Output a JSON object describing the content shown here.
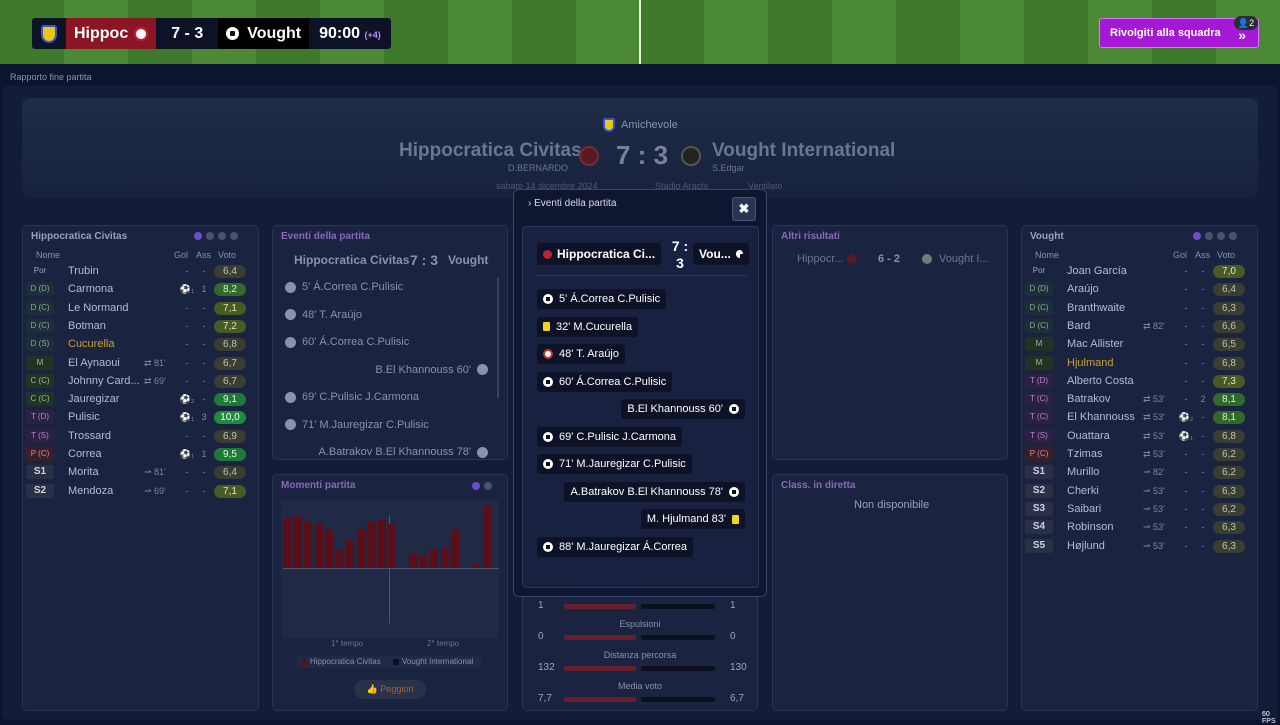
{
  "scorebar": {
    "home_team": "Hippoc",
    "score": "7 - 3",
    "away_team": "Vought",
    "time": "90:00",
    "added_time": "(+4)"
  },
  "talk_button": {
    "label": "Rivolgiti alla squadra",
    "badge": "2"
  },
  "report_label": "Rapporto fine partita",
  "header": {
    "competition": "Amichevole",
    "home_team": "Hippocratica Civitas",
    "away_team": "Vought International",
    "score": "7 : 3",
    "home_coach": "D.BERNARDO",
    "away_coach": "S.Edgar",
    "date": "sabato 14 dicembre 2024",
    "stadium": "Stadio Arachi",
    "weather": "Ventilato"
  },
  "home_lineup": {
    "title": "Hippocratica Civitas",
    "col_name": "Nome",
    "col_gol": "Gol",
    "col_ass": "Ass",
    "col_voto": "Voto",
    "players": [
      {
        "pos": "Por",
        "name": "Trubin",
        "gol": "-",
        "ass": "-",
        "voto": "6,4"
      },
      {
        "pos": "D (D)",
        "name": "Carmona",
        "gol": "⚽₁",
        "ass": "1",
        "voto": "8,2"
      },
      {
        "pos": "D (C)",
        "name": "Le Normand",
        "gol": "-",
        "ass": "-",
        "voto": "7,1"
      },
      {
        "pos": "D (C)",
        "name": "Botman",
        "gol": "-",
        "ass": "-",
        "voto": "7,2"
      },
      {
        "pos": "D (S)",
        "name": "Cucurella",
        "gol": "-",
        "ass": "-",
        "voto": "6,8"
      },
      {
        "pos": "M",
        "name": "El Aynaoui",
        "sub": "⇄ 81'",
        "gol": "-",
        "ass": "-",
        "voto": "6,7"
      },
      {
        "pos": "C (C)",
        "name": "Johnny Card...",
        "sub": "⇄ 69'",
        "gol": "-",
        "ass": "-",
        "voto": "6,7"
      },
      {
        "pos": "C (C)",
        "name": "Jauregizar",
        "gol": "⚽₂",
        "ass": "-",
        "voto": "9,1"
      },
      {
        "pos": "T (D)",
        "name": "Pulisic",
        "gol": "⚽₁",
        "ass": "3",
        "voto": "10,0"
      },
      {
        "pos": "T (S)",
        "name": "Trossard",
        "gol": "-",
        "ass": "-",
        "voto": "6,9"
      },
      {
        "pos": "P (C)",
        "name": "Correa",
        "gol": "⚽₁",
        "ass": "1",
        "voto": "9,5"
      },
      {
        "pos": "S1",
        "name": "Morita",
        "sub": "⇀ 81'",
        "gol": "-",
        "ass": "-",
        "voto": "6,4"
      },
      {
        "pos": "S2",
        "name": "Mendoza",
        "sub": "⇀ 69'",
        "gol": "-",
        "ass": "-",
        "voto": "7,1"
      }
    ]
  },
  "away_lineup": {
    "title": "Vought",
    "col_name": "Nome",
    "col_gol": "Gol",
    "col_ass": "Ass",
    "col_voto": "Voto",
    "players": [
      {
        "pos": "Por",
        "name": "Joan García",
        "gol": "-",
        "ass": "-",
        "voto": "7,0"
      },
      {
        "pos": "D (D)",
        "name": "Araújo",
        "gol": "-",
        "ass": "-",
        "voto": "6,4"
      },
      {
        "pos": "D (C)",
        "name": "Branthwaite",
        "gol": "-",
        "ass": "-",
        "voto": "6,3"
      },
      {
        "pos": "D (C)",
        "name": "Bard",
        "sub": "⇄ 82'",
        "gol": "-",
        "ass": "-",
        "voto": "6,6"
      },
      {
        "pos": "M",
        "name": "Mac Allister",
        "gol": "-",
        "ass": "-",
        "voto": "6,5"
      },
      {
        "pos": "M",
        "name": "Hjulmand",
        "gol": "-",
        "ass": "-",
        "voto": "6,8"
      },
      {
        "pos": "T (D)",
        "name": "Alberto Costa",
        "gol": "-",
        "ass": "-",
        "voto": "7,3"
      },
      {
        "pos": "T (C)",
        "name": "Batrakov",
        "sub": "⇄ 53'",
        "gol": "-",
        "ass": "2",
        "voto": "8,1"
      },
      {
        "pos": "T (C)",
        "name": "El Khannouss",
        "sub": "⇄ 53'",
        "gol": "⚽₂",
        "ass": "-",
        "voto": "8,1"
      },
      {
        "pos": "T (S)",
        "name": "Ouattara",
        "sub": "⇄ 53'",
        "gol": "⚽₁",
        "ass": "-",
        "voto": "6,8"
      },
      {
        "pos": "P (C)",
        "name": "Tzimas",
        "sub": "⇄ 53'",
        "gol": "-",
        "ass": "-",
        "voto": "6,2"
      },
      {
        "pos": "S1",
        "name": "Murillo",
        "sub": "⇀ 82'",
        "gol": "-",
        "ass": "-",
        "voto": "6,2"
      },
      {
        "pos": "S2",
        "name": "Cherki",
        "sub": "⇀ 53'",
        "gol": "-",
        "ass": "-",
        "voto": "6,3"
      },
      {
        "pos": "S3",
        "name": "Saibari",
        "sub": "⇀ 53'",
        "gol": "-",
        "ass": "-",
        "voto": "6,2"
      },
      {
        "pos": "S4",
        "name": "Robinson",
        "sub": "⇀ 53'",
        "gol": "-",
        "ass": "-",
        "voto": "6,3"
      },
      {
        "pos": "S5",
        "name": "Højlund",
        "sub": "⇀ 53'",
        "gol": "-",
        "ass": "-",
        "voto": "6,3"
      }
    ]
  },
  "events_panel": {
    "title": "Eventi della partita",
    "home": "Hippocratica Civitas",
    "score": "7 : 3",
    "away": "Vought",
    "events": [
      {
        "text": "5' Á.Correa C.Pulisic",
        "side": "home"
      },
      {
        "text": "48' T. Araújo",
        "side": "home"
      },
      {
        "text": "60' Á.Correa C.Pulisic",
        "side": "home"
      },
      {
        "text": "B.El Khannouss 60'",
        "side": "away"
      },
      {
        "text": "69' C.Pulisic J.Carmona",
        "side": "home"
      },
      {
        "text": "71' M.Jauregizar C.Pulisic",
        "side": "home"
      },
      {
        "text": "A.Batrakov B.El Khannouss 78'",
        "side": "away"
      }
    ]
  },
  "moments_panel": {
    "title": "Momenti partita",
    "first_half": "1° tempo",
    "second_half": "2° tempo",
    "legend_home": "Hippocratica Civitas",
    "legend_away": "Vought International",
    "worst_button": "Peggiori"
  },
  "others_panel": {
    "title": "Altri risultati",
    "home": "Hippocr...",
    "score": "6 - 2",
    "away": "Vought I..."
  },
  "live_table": {
    "title": "Class. in diretta",
    "empty": "Non disponibile"
  },
  "stats": [
    {
      "label": "",
      "home": "1",
      "away": "1"
    },
    {
      "label": "Espulsioni",
      "home": "0",
      "away": "0"
    },
    {
      "label": "Distanza percorsa",
      "home": "132",
      "away": "130"
    },
    {
      "label": "Media voto",
      "home": "7,7",
      "away": "6,7"
    }
  ],
  "modal": {
    "title": "Eventi della partita",
    "close": "✖",
    "home": "Hippocratica Ci...",
    "score": "7 : 3",
    "away": "Vou...",
    "events": [
      {
        "text": "5' Á.Correa C.Pulisic",
        "side": "home",
        "icon": "goal"
      },
      {
        "text": "32' M.Cucurella",
        "side": "home",
        "icon": "yellow"
      },
      {
        "text": "48' T. Araújo",
        "side": "home",
        "icon": "owngoal"
      },
      {
        "text": "60' Á.Correa C.Pulisic",
        "side": "home",
        "icon": "goal"
      },
      {
        "text": "B.El Khannouss 60'",
        "side": "away",
        "icon": "goal"
      },
      {
        "text": "69' C.Pulisic J.Carmona",
        "side": "home",
        "icon": "goal"
      },
      {
        "text": "71' M.Jauregizar C.Pulisic",
        "side": "home",
        "icon": "goal"
      },
      {
        "text": "A.Batrakov B.El Khannouss 78'",
        "side": "away",
        "icon": "goal"
      },
      {
        "text": "M. Hjulmand 83'",
        "side": "away",
        "icon": "yellow"
      },
      {
        "text": "88' M.Jauregizar Á.Correa",
        "side": "home",
        "icon": "goal"
      }
    ]
  },
  "fps": "60 FPS",
  "colors": {
    "accent": "#a418d6",
    "home": "#8a1625",
    "panel": "#1a233f"
  }
}
